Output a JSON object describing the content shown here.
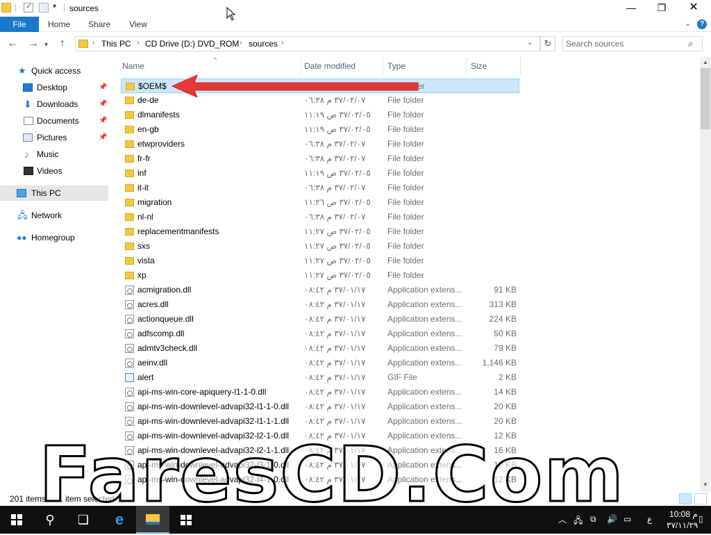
{
  "window": {
    "title": "sources"
  },
  "ribbon": {
    "tabs": [
      {
        "label": "File"
      },
      {
        "label": "Home"
      },
      {
        "label": "Share"
      },
      {
        "label": "View"
      }
    ]
  },
  "address": {
    "breadcrumbs": [
      "This PC",
      "CD Drive (D:) DVD_ROM",
      "sources"
    ]
  },
  "search": {
    "placeholder": "Search sources"
  },
  "navpane": {
    "items": [
      {
        "label": "Quick access",
        "icon": "star-icon"
      },
      {
        "label": "Desktop",
        "icon": "desktop-icon",
        "pinned": true
      },
      {
        "label": "Downloads",
        "icon": "downloads-icon",
        "pinned": true
      },
      {
        "label": "Documents",
        "icon": "documents-icon",
        "pinned": true
      },
      {
        "label": "Pictures",
        "icon": "pictures-icon",
        "pinned": true
      },
      {
        "label": "Music",
        "icon": "music-icon"
      },
      {
        "label": "Videos",
        "icon": "videos-icon"
      },
      {
        "label": "This PC",
        "icon": "computer-icon",
        "selected": true
      },
      {
        "label": "Network",
        "icon": "network-icon"
      },
      {
        "label": "Homegroup",
        "icon": "homegroup-icon"
      }
    ]
  },
  "columns": {
    "name": "Name",
    "date": "Date modified",
    "type": "Type",
    "size": "Size"
  },
  "files": [
    {
      "name": "$OEM$",
      "date": "",
      "type": "File folder",
      "size": "",
      "kind": "folder",
      "selected": true
    },
    {
      "name": "de-de",
      "date": "٣٧/٠٢/٠٧ م ٠٦:٣٨",
      "type": "File folder",
      "size": "",
      "kind": "folder"
    },
    {
      "name": "dlmanifests",
      "date": "٣٧/٠٢/٠٥ ص ١١:١٩",
      "type": "File folder",
      "size": "",
      "kind": "folder"
    },
    {
      "name": "en-gb",
      "date": "٣٧/٠٢/٠٥ ص ١١:١٩",
      "type": "File folder",
      "size": "",
      "kind": "folder"
    },
    {
      "name": "etwproviders",
      "date": "٣٧/٠٢/٠٧ م ٠٦:٣٨",
      "type": "File folder",
      "size": "",
      "kind": "folder"
    },
    {
      "name": "fr-fr",
      "date": "٣٧/٠٢/٠٧ م ٠٦:٣٨",
      "type": "File folder",
      "size": "",
      "kind": "folder"
    },
    {
      "name": "inf",
      "date": "٣٧/٠٢/٠٥ ص ١١:١٩",
      "type": "File folder",
      "size": "",
      "kind": "folder"
    },
    {
      "name": "it-it",
      "date": "٣٧/٠٢/٠٧ م ٠٦:٣٨",
      "type": "File folder",
      "size": "",
      "kind": "folder"
    },
    {
      "name": "migration",
      "date": "٣٧/٠٢/٠٥ ص ١١:٢٦",
      "type": "File folder",
      "size": "",
      "kind": "folder"
    },
    {
      "name": "nl-nl",
      "date": "٣٧/٠٢/٠٧ م ٠٦:٣٨",
      "type": "File folder",
      "size": "",
      "kind": "folder"
    },
    {
      "name": "replacementmanifests",
      "date": "٣٧/٠٢/٠٥ ص ١١:٢٧",
      "type": "File folder",
      "size": "",
      "kind": "folder"
    },
    {
      "name": "sxs",
      "date": "٣٧/٠٢/٠٥ ص ١١:٢٧",
      "type": "File folder",
      "size": "",
      "kind": "folder"
    },
    {
      "name": "vista",
      "date": "٣٧/٠٢/٠٥ ص ١١:٢٧",
      "type": "File folder",
      "size": "",
      "kind": "folder"
    },
    {
      "name": "xp",
      "date": "٣٧/٠٢/٠٥ ص ١١:٢٧",
      "type": "File folder",
      "size": "",
      "kind": "folder"
    },
    {
      "name": "acmigration.dll",
      "date": "٣٧/٠١/١٧ م ٠٨:٤٢",
      "type": "Application extens...",
      "size": "91 KB",
      "kind": "dll"
    },
    {
      "name": "acres.dll",
      "date": "٣٧/٠١/١٧ م ٠٨:٤٢",
      "type": "Application extens...",
      "size": "313 KB",
      "kind": "dll"
    },
    {
      "name": "actionqueue.dll",
      "date": "٣٧/٠١/١٧ م ٠٨:٤٢",
      "type": "Application extens...",
      "size": "224 KB",
      "kind": "dll"
    },
    {
      "name": "adfscomp.dll",
      "date": "٣٧/٠١/١٧ م ٠٨:٤٢",
      "type": "Application extens...",
      "size": "50 KB",
      "kind": "dll"
    },
    {
      "name": "admtv3check.dll",
      "date": "٣٧/٠١/١٧ م ٠٨:٤٢",
      "type": "Application extens...",
      "size": "79 KB",
      "kind": "dll"
    },
    {
      "name": "aeinv.dll",
      "date": "٣٧/٠١/١٧ م ٠٨:٤٢",
      "type": "Application extens...",
      "size": "1,146 KB",
      "kind": "dll"
    },
    {
      "name": "alert",
      "date": "٣٧/٠١/١٧ م ٠٨:٤٢",
      "type": "GIF File",
      "size": "2 KB",
      "kind": "gif"
    },
    {
      "name": "api-ms-win-core-apiquery-l1-1-0.dll",
      "date": "٣٧/٠١/١٧ م ٠٨:٤٢",
      "type": "Application extens...",
      "size": "14 KB",
      "kind": "dll"
    },
    {
      "name": "api-ms-win-downlevel-advapi32-l1-1-0.dll",
      "date": "٣٧/٠١/١٧ م ٠٨:٤٢",
      "type": "Application extens...",
      "size": "20 KB",
      "kind": "dll"
    },
    {
      "name": "api-ms-win-downlevel-advapi32-l1-1-1.dll",
      "date": "٣٧/٠١/١٧ م ٠٨:٤٢",
      "type": "Application extens...",
      "size": "20 KB",
      "kind": "dll"
    },
    {
      "name": "api-ms-win-downlevel-advapi32-l2-1-0.dll",
      "date": "٣٧/٠١/١٧ م ٠٨:٤٢",
      "type": "Application extens...",
      "size": "12 KB",
      "kind": "dll"
    },
    {
      "name": "api-ms-win-downlevel-advapi32-l2-1-1.dll",
      "date": "٣٧/٠١/١٧ م ٠٨:٤٢",
      "type": "Application extens...",
      "size": "16 KB",
      "kind": "dll"
    },
    {
      "name": "api-ms-win-downlevel-advapi32-l3-1-0.dll",
      "date": "٣٧/٠١/١٧ م ٠٨:٤٢",
      "type": "Application extens...",
      "size": "12 KB",
      "kind": "dll"
    },
    {
      "name": "api-ms-win-downlevel-advapi32-l4-1-0.dll",
      "date": "٣٧/٠١/١٧ م ٠٨:٤٢",
      "type": "Application extens...",
      "size": "12 KB",
      "kind": "dll"
    }
  ],
  "status": {
    "item_count": "201 items",
    "selection": "1 item selected"
  },
  "watermark": {
    "text": "FaresCD.Com"
  },
  "taskbar": {
    "clock_time": "م 10:08",
    "clock_date": "٣٧/١١/٢٩",
    "language": "ع"
  },
  "colors": {
    "accent": "#1979ca",
    "selection": "#cce8ff",
    "annotation_arrow": "#e53935",
    "folder": "#f4c842"
  }
}
